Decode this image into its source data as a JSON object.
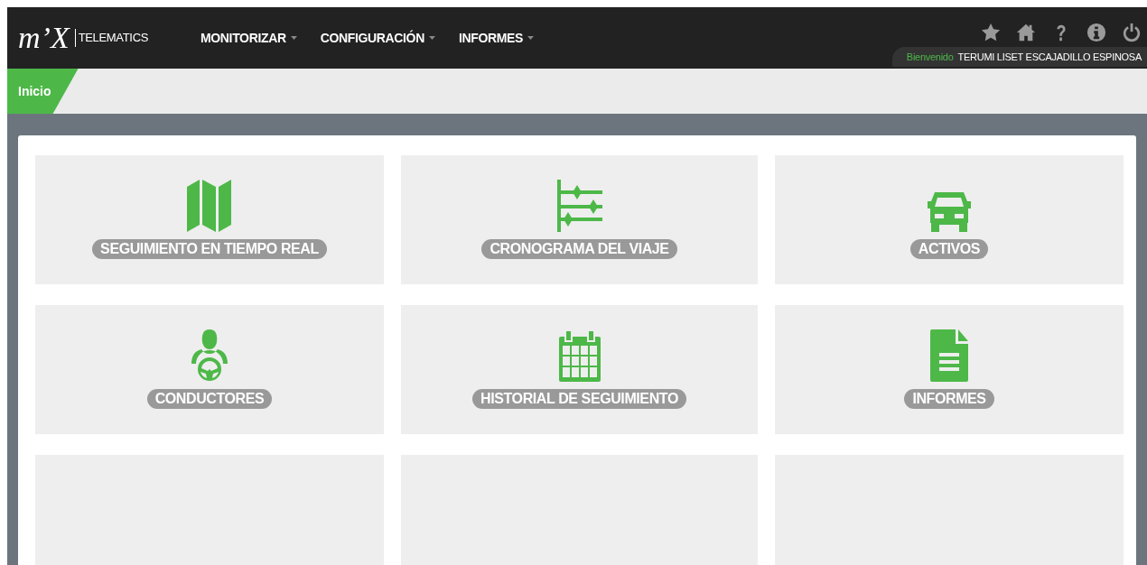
{
  "logo": {
    "mark": "m’X",
    "name": "TELEMATICS"
  },
  "nav": [
    {
      "label": "MONITORIZAR"
    },
    {
      "label": "CONFIGURACIÓN"
    },
    {
      "label": "INFORMES"
    }
  ],
  "header_icons": [
    {
      "kind": "star"
    },
    {
      "kind": "home"
    },
    {
      "kind": "help"
    },
    {
      "kind": "info"
    },
    {
      "kind": "power"
    }
  ],
  "user": {
    "greeting": "Bienvenido",
    "name": "TERUMI LISET ESCAJADILLO ESPINOSA"
  },
  "breadcrumb": "Inicio",
  "tiles": [
    {
      "kind": "map",
      "label": "SEGUIMIENTO EN TIEMPO REAL"
    },
    {
      "kind": "timeline",
      "label": "CRONOGRAMA DEL VIAJE"
    },
    {
      "kind": "car",
      "label": "ACTIVOS"
    },
    {
      "kind": "driver",
      "label": "CONDUCTORES"
    },
    {
      "kind": "calendar",
      "label": "HISTORIAL DE SEGUIMIENTO"
    },
    {
      "kind": "document",
      "label": "INFORMES"
    },
    {
      "kind": "empty"
    },
    {
      "kind": "empty"
    },
    {
      "kind": "empty"
    }
  ]
}
